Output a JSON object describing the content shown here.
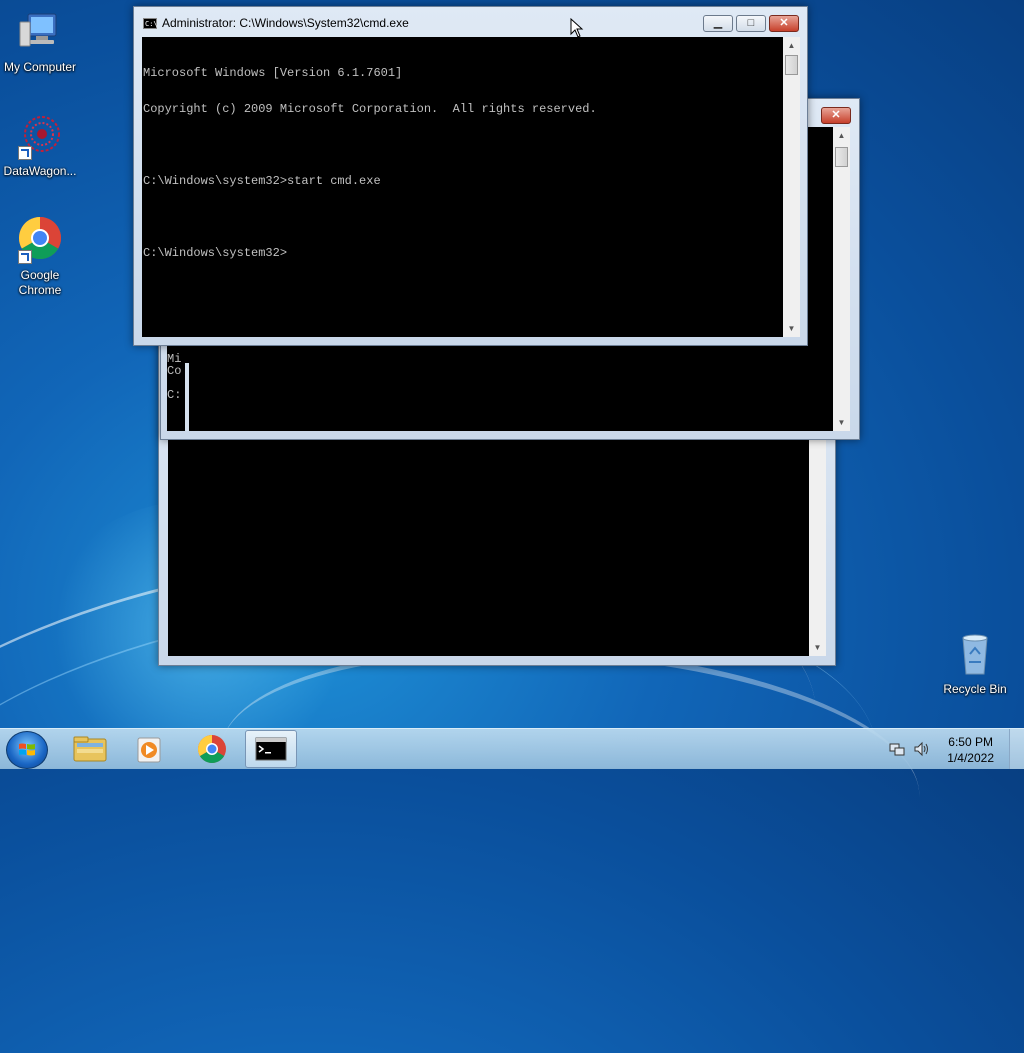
{
  "desktop": {
    "icons": [
      {
        "label": "My Computer",
        "icon": "computer-icon"
      },
      {
        "label": "DataWagon...",
        "icon": "datawagon-icon"
      },
      {
        "label": "Google\nChrome",
        "icon": "chrome-icon"
      },
      {
        "label": "Recycle Bin",
        "icon": "recycle-bin-icon"
      }
    ]
  },
  "windows": {
    "front": {
      "title": "Administrator: C:\\Windows\\System32\\cmd.exe",
      "console_lines": [
        "Microsoft Windows [Version 6.1.7601]",
        "Copyright (c) 2009 Microsoft Corporation.  All rights reserved.",
        "",
        "C:\\Windows\\system32>start cmd.exe",
        "",
        "C:\\Windows\\system32>"
      ]
    },
    "middle": {
      "console_lines": [
        "Mi",
        "Co",
        "",
        "C:"
      ]
    },
    "back": {
      "console_lines": []
    }
  },
  "taskbar": {
    "start": "start-orb-icon",
    "pinned": [
      "explorer-icon",
      "media-player-icon",
      "chrome-icon",
      "cmd-icon"
    ],
    "clock_time": "6:50 PM",
    "clock_date": "1/4/2022"
  }
}
